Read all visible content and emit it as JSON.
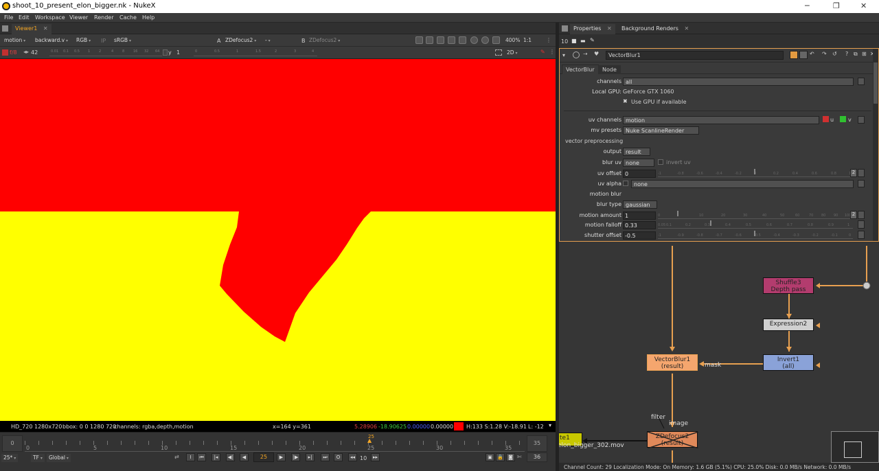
{
  "window": {
    "title": "shoot_10_present_elon_bigger.nk - NukeX",
    "minimize": "─",
    "maximize": "❐",
    "close": "✕"
  },
  "menu": [
    "File",
    "Edit",
    "Workspace",
    "Viewer",
    "Render",
    "Cache",
    "Help"
  ],
  "viewer": {
    "tab_label": "Viewer1",
    "tab_close": "✕",
    "channel_set": "motion",
    "layer": "backward.v",
    "display_channels": "RGB",
    "ip_label": "IP",
    "lut": "sRGB",
    "a_label": "A",
    "a_input": "ZDefocus2",
    "wipe_mode": "-",
    "b_label": "B",
    "b_input": "ZDefocus2",
    "zoom": "400%",
    "proxy_ratio": "1:1",
    "gain_label": "f/8",
    "gain_value": "42",
    "y_label": "y",
    "gamma_value": "1",
    "view_mode": "2D",
    "gain_ticks": [
      "0.01",
      "0.1",
      "0.5",
      "1",
      "2",
      "4",
      "8",
      "16",
      "32",
      "64"
    ],
    "gamma_ticks": [
      "0",
      "0.5",
      "1",
      "1.5",
      "2",
      "3",
      "4"
    ],
    "info": {
      "format": "HD_720 1280x720",
      "bbox": "bbox: 0 0 1280 720",
      "channels": "channels: rgba,depth,motion",
      "coords": "x=164 y=361",
      "r": "5.28906",
      "g": "-18.90625",
      "b": "0.00000",
      "a": "0.00000",
      "hsv": "H:133 S:1.28 V:-18.91",
      "luma": "L: -12"
    },
    "colors": {
      "red": "#ff0000",
      "yellow": "#ffff00"
    }
  },
  "timeline": {
    "start_frame": "0",
    "end_frame": "35",
    "current_frame": "25",
    "ticks": [
      "0",
      "5",
      "10",
      "15",
      "20",
      "25",
      "30",
      "35"
    ],
    "fps": "25*",
    "tf": "TF",
    "range_mode": "Global",
    "frame_field": "25",
    "increment": "10",
    "end_field": "36",
    "i_label": "I",
    "o_label": "O"
  },
  "properties": {
    "tabs": [
      "Properties",
      "Background Renders"
    ],
    "max_panels": "10",
    "node_name": "VectorBlur1",
    "subtabs": [
      "VectorBlur",
      "Node"
    ],
    "rows": {
      "channels": {
        "label": "channels",
        "value": "all"
      },
      "local_gpu": {
        "label": "Local GPU:",
        "value": "GeForce GTX 1060"
      },
      "use_gpu": {
        "label": "Use GPU if available",
        "checked": true
      },
      "uv_channels": {
        "label": "uv channels",
        "value": "motion",
        "u": "u",
        "v": "v"
      },
      "mv_presets": {
        "label": "mv presets",
        "value": "Nuke ScanlineRender"
      },
      "vector_preprocessing": {
        "label": "vector preprocessing"
      },
      "output": {
        "label": "output",
        "value": "result"
      },
      "blur_uv": {
        "label": "blur uv",
        "value": "none",
        "invert_label": "invert uv"
      },
      "uv_offset": {
        "label": "uv offset",
        "value": "0",
        "ticks": [
          "-1",
          "-0.8",
          "-0.6",
          "-0.4",
          "-0.2",
          "0",
          "0.2",
          "0.4",
          "0.6",
          "0.8",
          "1"
        ]
      },
      "uv_alpha": {
        "label": "uv alpha",
        "value": "none"
      },
      "motion_blur": {
        "label": "motion blur"
      },
      "blur_type": {
        "label": "blur type",
        "value": "gaussian"
      },
      "motion_amount": {
        "label": "motion amount",
        "value": "1",
        "ticks": [
          "0",
          "10",
          "20",
          "30",
          "40",
          "50",
          "60",
          "70",
          "80",
          "90",
          "100"
        ]
      },
      "motion_falloff": {
        "label": "motion falloff",
        "value": "0.33",
        "ticks": [
          "0.05",
          "0.1",
          "0.2",
          "0.3",
          "0.4",
          "0.5",
          "0.6",
          "0.7",
          "0.8",
          "0.9",
          "1"
        ]
      },
      "shutter_offset": {
        "label": "shutter offset",
        "value": "-0.5",
        "ticks": [
          "-1",
          "-0.9",
          "-0.8",
          "-0.7",
          "-0.6",
          "-0.5",
          "-0.4",
          "-0.3",
          "-0.2",
          "-0.1",
          "0"
        ]
      }
    },
    "anim_count": "2"
  },
  "nodegraph": {
    "nodes": {
      "shuffle": {
        "name": "Shuffle3",
        "label": "Depth pass"
      },
      "expression": {
        "name": "Expression2"
      },
      "invert": {
        "name": "Invert1",
        "label": "(all)"
      },
      "vectorblur": {
        "name": "VectorBlur1",
        "label": "(result)"
      },
      "zdefocus": {
        "name": "ZDefocus2",
        "label": "(result)"
      },
      "write_partial": {
        "name": "te1",
        "label": "elon_bigger_302.mov"
      }
    },
    "edge_labels": {
      "mask": "mask",
      "filter": "filter",
      "image": "image"
    },
    "colors": {
      "shuffle": "#b33c6e",
      "expression": "#cfcfcf",
      "invert": "#8aa2d8",
      "vectorblur": "#f5a66e",
      "zdefocus": "#e0895a",
      "write": "#c8c800"
    }
  },
  "status": "Channel Count: 29  Localization Mode: On  Memory: 1.6 GB (5.1%)  CPU: 25.0%  Disk: 0.0 MB/s  Network: 0.0 MB/s"
}
